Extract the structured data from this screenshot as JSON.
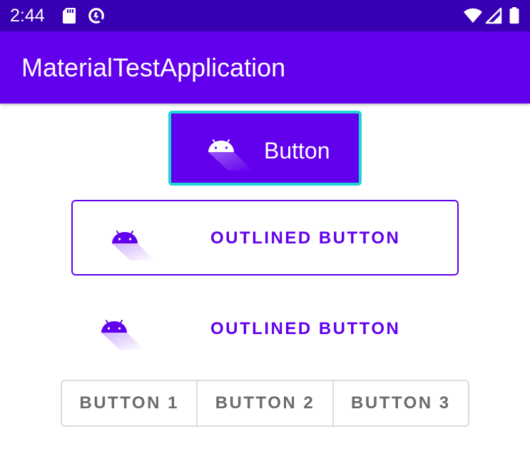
{
  "status_bar": {
    "time": "2:44",
    "icons": [
      "sd-card-icon",
      "data-saver-icon",
      "wifi-icon",
      "signal-icon",
      "battery-icon"
    ]
  },
  "app_bar": {
    "title": "MaterialTestApplication"
  },
  "colors": {
    "primary": "#6200EE",
    "primary_dark": "#3700B3",
    "focus_outline": "#1ED6D6",
    "toggle_text": "#6b6b6b"
  },
  "filled_button": {
    "label": "Button",
    "icon": "android-icon"
  },
  "outlined_button": {
    "label": "OUTLINED BUTTON",
    "icon": "android-icon"
  },
  "text_button": {
    "label": "OUTLINED BUTTON",
    "icon": "android-icon"
  },
  "toggle_group": {
    "buttons": [
      {
        "label": "BUTTON 1"
      },
      {
        "label": "BUTTON 2"
      },
      {
        "label": "BUTTON 3"
      }
    ]
  }
}
